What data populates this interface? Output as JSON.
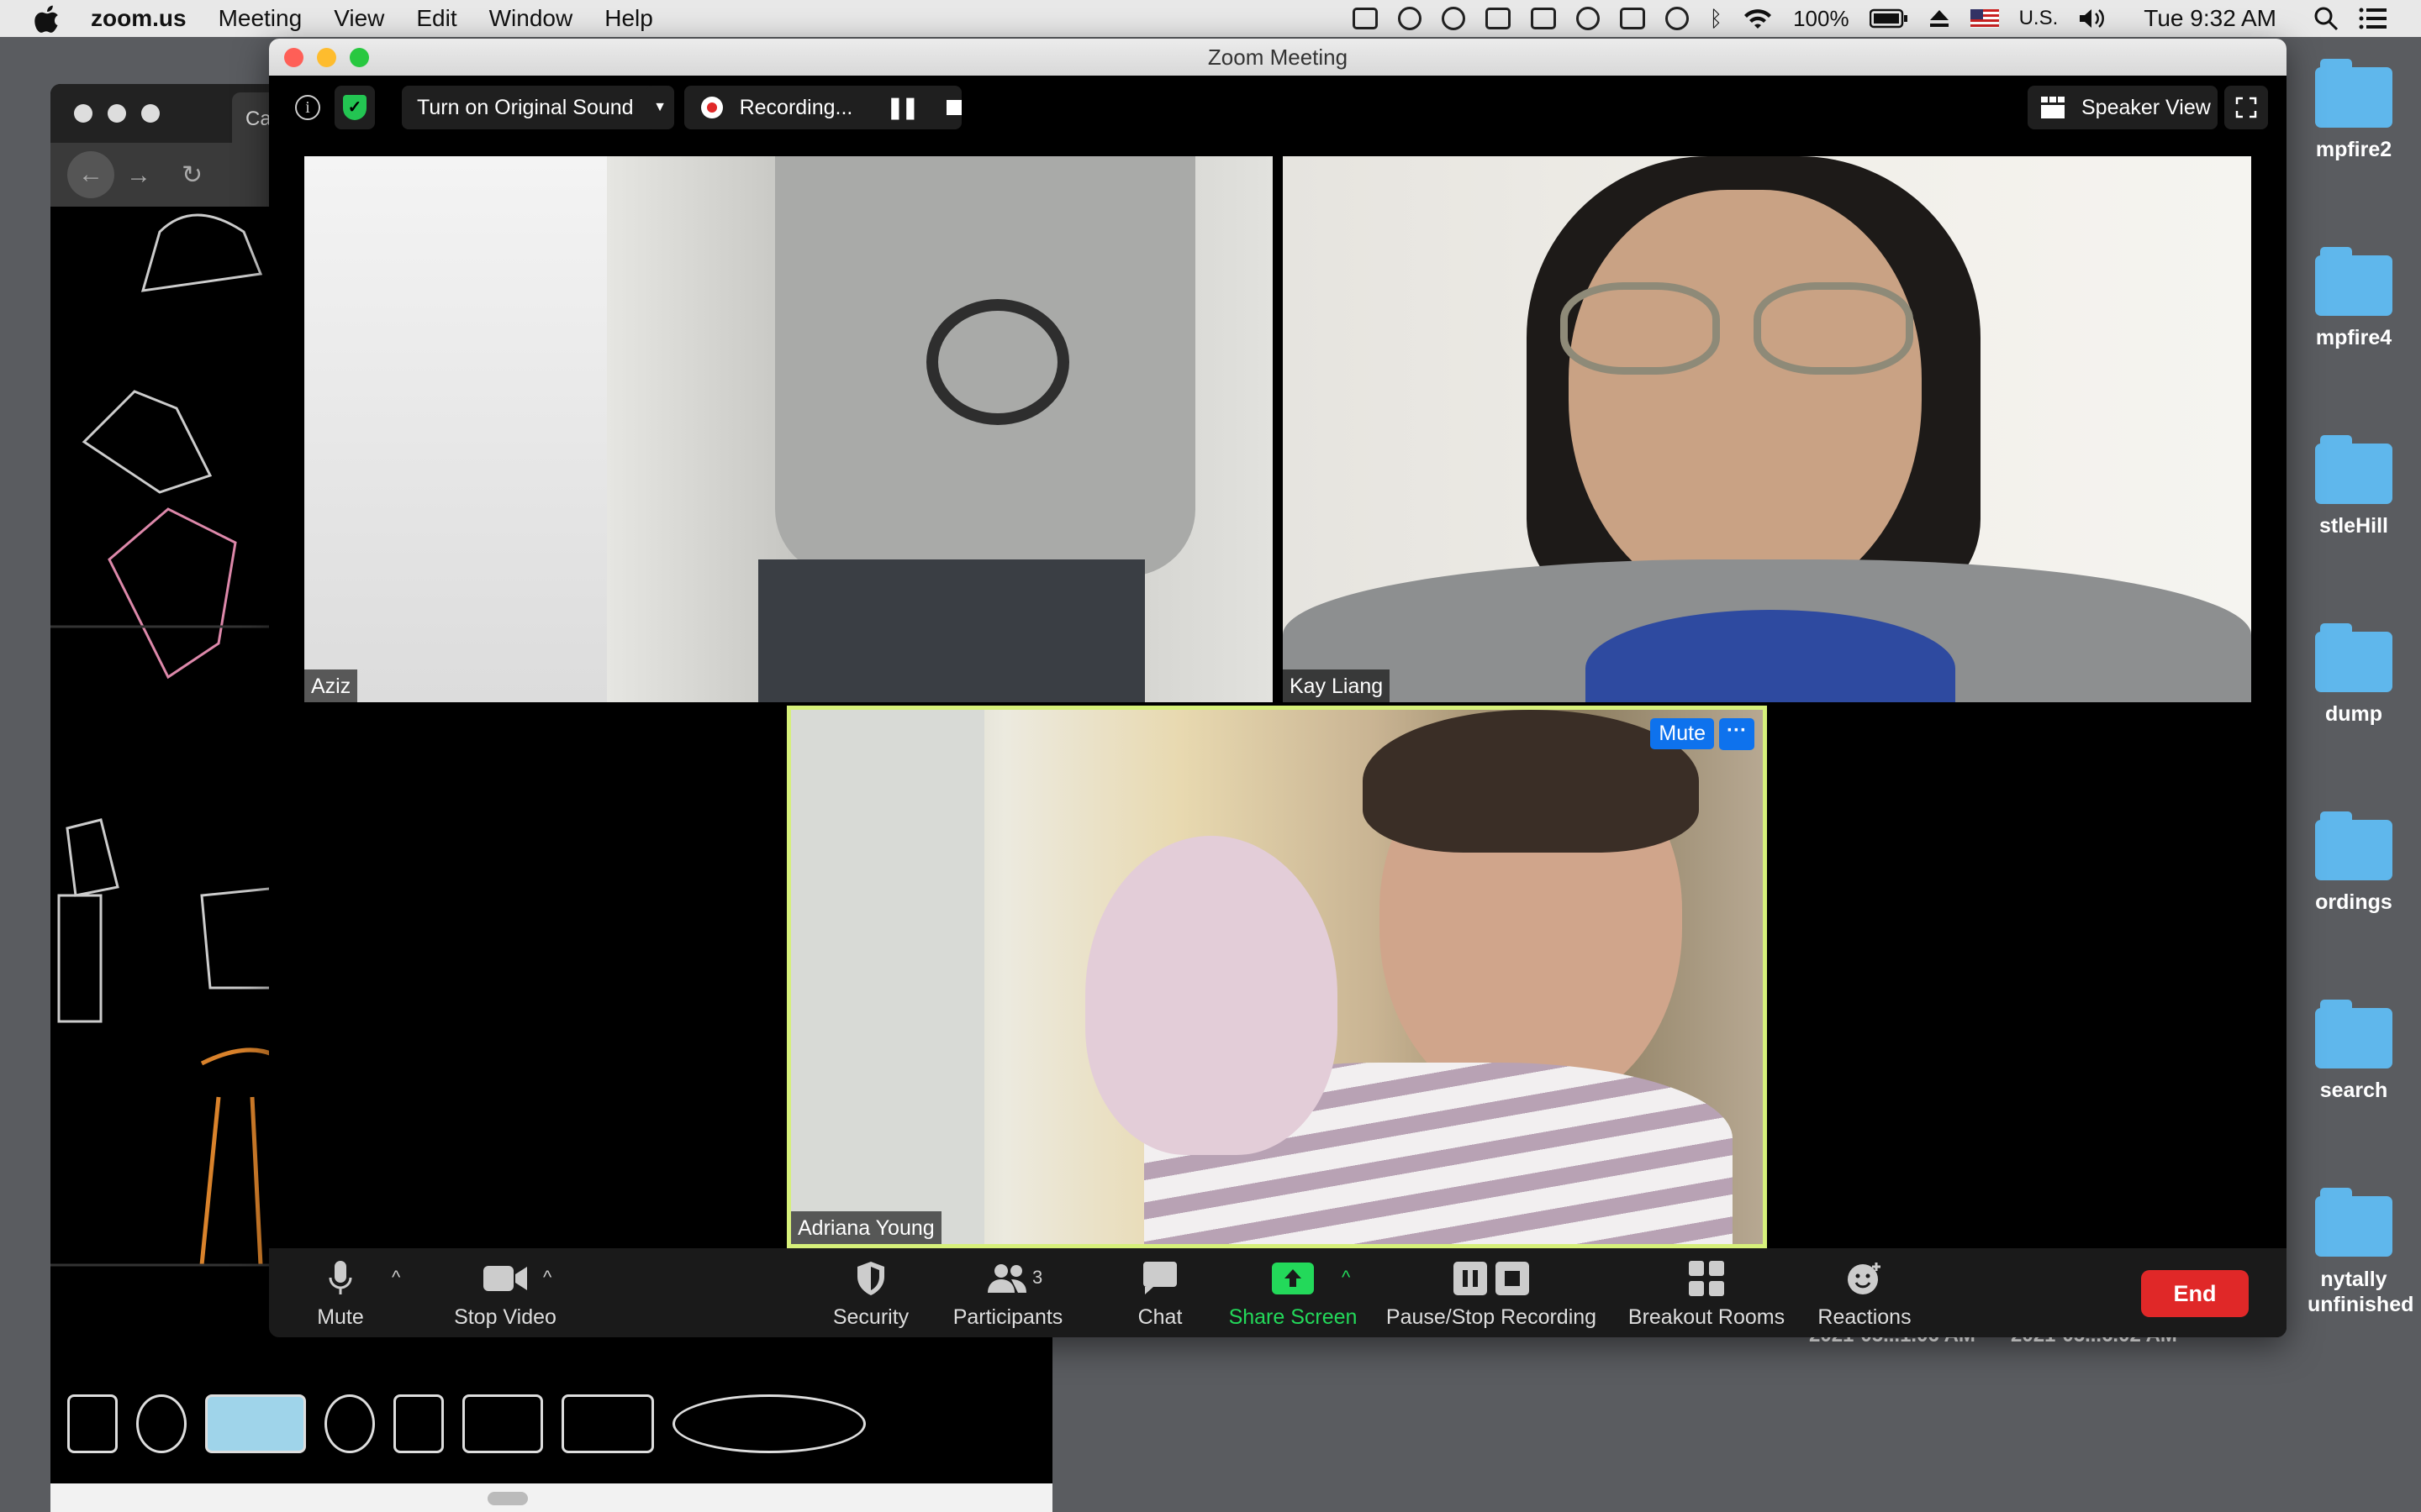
{
  "menubar": {
    "app": "zoom.us",
    "items": [
      "Meeting",
      "View",
      "Edit",
      "Window",
      "Help"
    ],
    "battery": "100%",
    "input_source": "U.S.",
    "clock": "Tue 9:32 AM"
  },
  "desktop": {
    "folders": [
      "mpfire2",
      "mpfire4",
      "stleHill",
      "dump",
      "ordings",
      "search",
      "nytally unfinished"
    ],
    "footer_dates": [
      "2021-05...1.06 AM",
      "2021-05...6.02 AM"
    ]
  },
  "background_window": {
    "tab_label": "Ca"
  },
  "zoom": {
    "window_title": "Zoom Meeting",
    "original_sound_label": "Turn on Original Sound",
    "recording_label": "Recording...",
    "speaker_view_label": "Speaker View",
    "participants": [
      {
        "name": "Aziz"
      },
      {
        "name": "Kay Liang"
      },
      {
        "name": "Adriana Young",
        "active": true
      }
    ],
    "active_tile_mute": "Mute",
    "active_tile_more": "···",
    "toolbar": {
      "mute": "Mute",
      "stop_video": "Stop Video",
      "security": "Security",
      "participants": "Participants",
      "participants_count": "3",
      "chat": "Chat",
      "share_screen": "Share Screen",
      "recording": "Pause/Stop Recording",
      "breakout": "Breakout Rooms",
      "reactions": "Reactions",
      "end": "End"
    },
    "colors": {
      "share_green": "#23d95a",
      "end_red": "#e02828",
      "mute_blue": "#0e72ed",
      "active_border": "#d6f07a"
    }
  }
}
